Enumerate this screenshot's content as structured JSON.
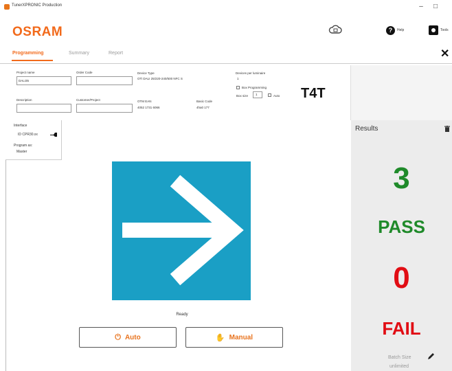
{
  "window": {
    "title": "TunerXPRONIC Production",
    "minimize": "–",
    "maximize": "□"
  },
  "header": {
    "logo": "OSRAM",
    "help_label": "Help",
    "tools_label": "Tools"
  },
  "tabs": [
    {
      "label": "Programming",
      "active": true
    },
    {
      "label": "Summary",
      "active": false
    },
    {
      "label": "Report",
      "active": false
    }
  ],
  "info": {
    "project_name_label": "Project name",
    "project_name_value": "DALI35",
    "order_code_label": "Order Code",
    "order_code_value": "",
    "device_type_label": "Device Type",
    "device_type_value": "OTi DALI 25/220-240/500 NFC S",
    "devices_per_luminaire_label": "Devices per luminaire",
    "devices_per_luminaire_value": "1",
    "box_programming_label": "Box Programming",
    "box_size_label": "Box size",
    "box_size_value": "1",
    "auto_label": "Auto",
    "description_label": "Description",
    "description_value": "",
    "customer_project_label": "Customer/Project",
    "customer_project_value": "",
    "otm_ean_label": "OTM EAN",
    "otm_ean_value": "4052 1731 6066",
    "basic_code_label": "Basic Code",
    "basic_code_value": "4ha0 177",
    "badge": "T4T"
  },
  "interface": {
    "label": "Interface",
    "value": "ID CPR30.xx",
    "program_as_label": "Program as:",
    "program_as_value": "Master"
  },
  "center": {
    "status": "Ready",
    "auto_button": "Auto",
    "manual_button": "Manual"
  },
  "results": {
    "title": "Results",
    "pass_count": "3",
    "pass_label": "PASS",
    "fail_count": "0",
    "fail_label": "FAIL",
    "batch_size_label": "Batch Size",
    "batch_size_value": "unlimited"
  },
  "colors": {
    "brand": "#f26a1b",
    "tile": "#1a9fc5",
    "pass": "#1f8a2a",
    "fail": "#e10d14"
  }
}
